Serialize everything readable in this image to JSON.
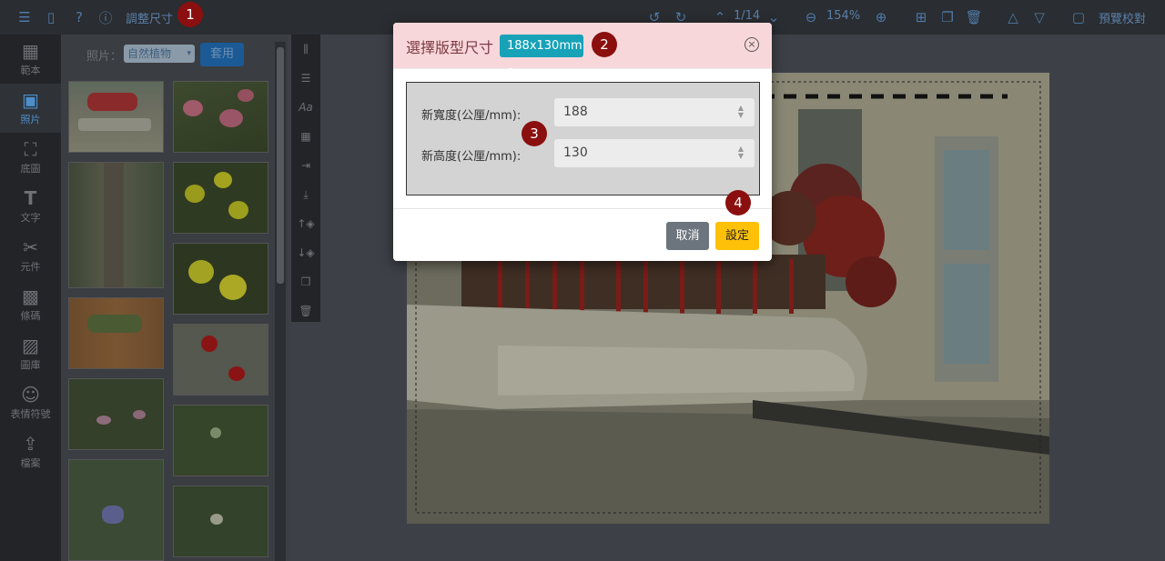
{
  "topbar": {
    "resize_label": "調整尺寸",
    "page_counter": "1/14",
    "zoom_level": "154%",
    "preview_label": "預覽校對"
  },
  "sidebar": {
    "items": [
      {
        "label": "範本",
        "icon": "template-icon"
      },
      {
        "label": "照片",
        "icon": "photo-icon"
      },
      {
        "label": "底圖",
        "icon": "background-icon"
      },
      {
        "label": "文字",
        "icon": "text-icon"
      },
      {
        "label": "元件",
        "icon": "component-icon"
      },
      {
        "label": "條碼",
        "icon": "qrcode-icon"
      },
      {
        "label": "圖庫",
        "icon": "gallery-icon"
      },
      {
        "label": "表情符號",
        "icon": "emoji-icon"
      },
      {
        "label": "檔案",
        "icon": "upload-icon"
      }
    ]
  },
  "photo_panel": {
    "filter_label": "照片：",
    "filter_value": "自然植物",
    "apply_label": "套用"
  },
  "modal": {
    "title": "選擇版型尺寸",
    "size_dropdown": "188x130mm",
    "width_label": "新寬度(公厘/mm):",
    "width_value": "188",
    "height_label": "新高度(公厘/mm):",
    "height_value": "130",
    "cancel_label": "取消",
    "set_label": "設定"
  },
  "annotations": [
    "1",
    "2",
    "3",
    "4"
  ]
}
